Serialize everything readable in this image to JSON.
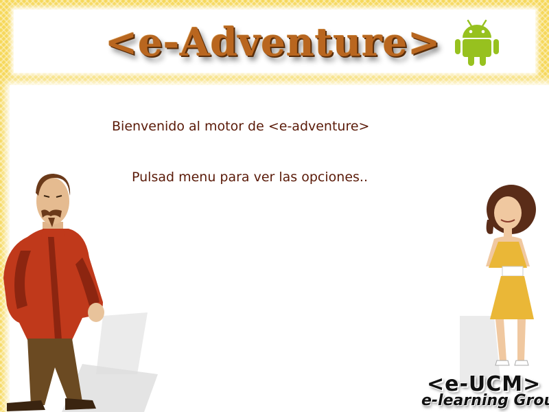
{
  "header": {
    "logo_text": "<e-Adventure>",
    "platform_icon": "android-icon",
    "android_color": "#97c11f"
  },
  "main": {
    "welcome_text": "Bienvenido al motor de <e-adventure>",
    "hint_text": "Pulsad menu para ver las opciones.."
  },
  "footer_logo": {
    "line1": "<e-UCM>",
    "line2": "e-learning Group"
  },
  "colors": {
    "frame": "#f6d85a",
    "text": "#5a1a08",
    "logo": "#b9661f"
  }
}
